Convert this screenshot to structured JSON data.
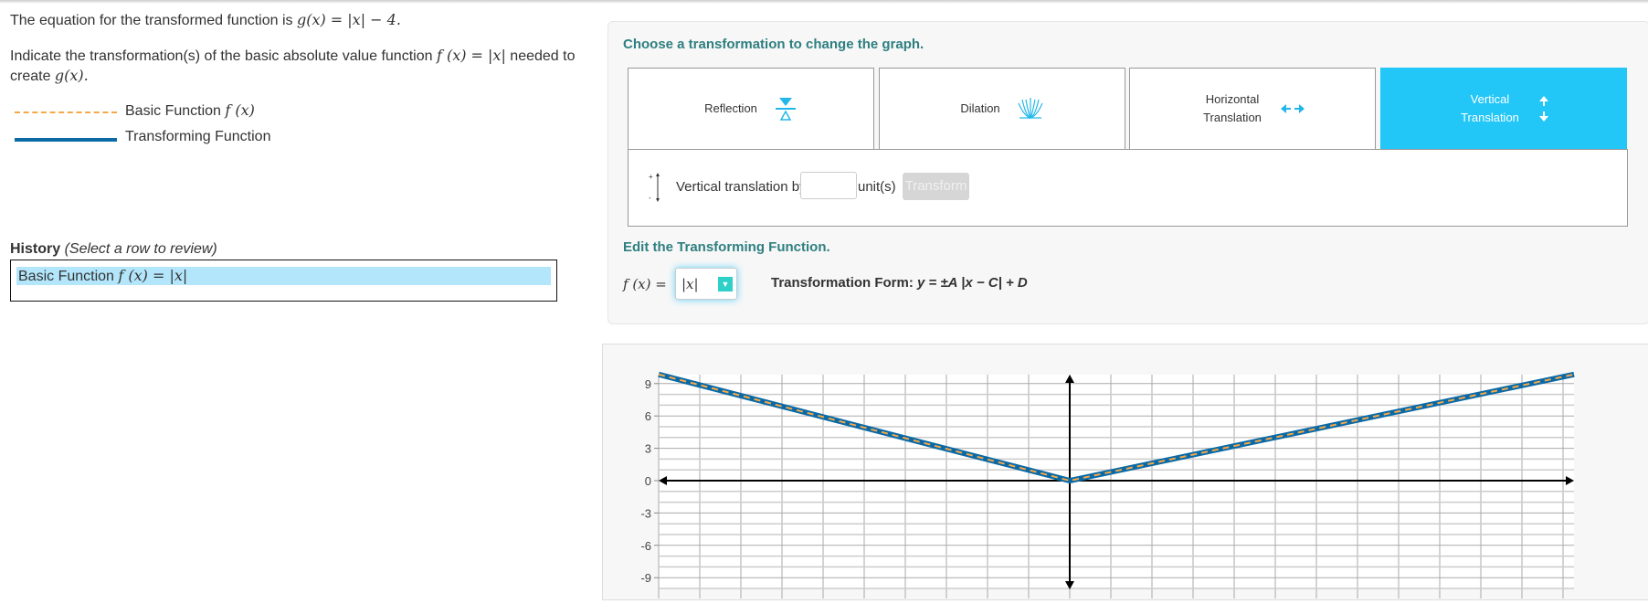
{
  "prompt": {
    "line1_prefix": "The equation for the transformed function is ",
    "g_equation": "g(x) = |x| − 4.",
    "line2_prefix": "Indicate the transformation(s) of the basic absolute value function ",
    "f_equation": "f (x) = |x|",
    "line2_suffix": " needed to",
    "line3_prefix": "create ",
    "line3_math": "g(x)."
  },
  "legend": {
    "basic_label": "Basic Function ",
    "basic_math": "f (x)",
    "transforming_label": "Transforming Function",
    "basic_color": "#f5a84a",
    "transforming_color": "#0b6aa6"
  },
  "history": {
    "title": "History",
    "hint": "(Select a row to review)",
    "rows": [
      {
        "label": "Basic Function ",
        "math": "f (x) = |x|",
        "selected": true
      }
    ]
  },
  "transform_panel": {
    "heading": "Choose a transformation to change the graph.",
    "buttons": [
      {
        "label": "Reflection",
        "icon": "reflection-icon",
        "active": false
      },
      {
        "label": "Dilation",
        "icon": "dilation-icon",
        "active": false
      },
      {
        "label": "Horizontal Translation",
        "icon": "horizontal-arrows-icon",
        "active": false
      },
      {
        "label": "Vertical Translation",
        "icon": "vertical-arrows-icon",
        "active": true
      }
    ],
    "option": {
      "label": "Vertical translation by",
      "value": "",
      "unit": "unit(s)",
      "transform_button": "Transform",
      "transform_enabled": false
    }
  },
  "edit": {
    "heading": "Edit the Transforming Function.",
    "fx_label": "f (x) =",
    "selected_function": "|x|",
    "form_label": "Transformation Form: ",
    "form_math": "y = ±A |x − C| + D"
  },
  "chart_data": {
    "type": "line",
    "xlim": [
      -10,
      10
    ],
    "ylim": [
      -10,
      10
    ],
    "ytick_labels": [
      "9",
      "6",
      "3",
      "0",
      "-3",
      "-6",
      "-9"
    ],
    "yticks": [
      9,
      6,
      3,
      0,
      -3,
      -6,
      -9
    ],
    "grid": true,
    "series": [
      {
        "style": "solid",
        "color": "#0b6aa6",
        "x": [
          -10,
          0,
          10
        ],
        "y": [
          10,
          0,
          10
        ]
      },
      {
        "style": "dashed",
        "color": "#f5a84a",
        "x": [
          -10,
          0,
          10
        ],
        "y": [
          10,
          0,
          10
        ]
      }
    ]
  }
}
